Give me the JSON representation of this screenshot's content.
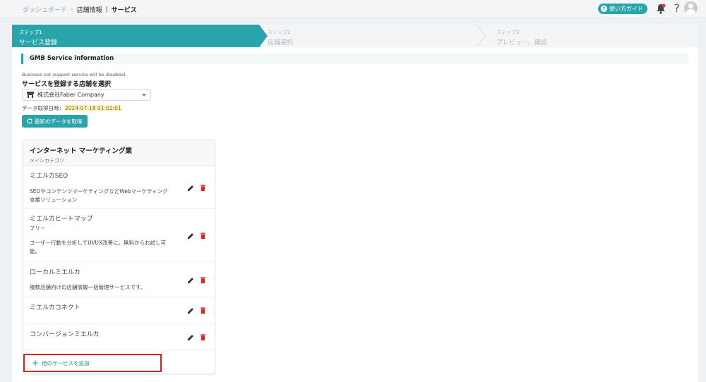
{
  "breadcrumb": {
    "items": [
      "ダッシュボード",
      "店舗情報",
      "サービス"
    ],
    "sep1": "›",
    "sep2": "|"
  },
  "topbar": {
    "guide_label": "使い方ガイド",
    "help_glyph": "?"
  },
  "steps": [
    {
      "num": "ステップ1",
      "label": "サービス登録"
    },
    {
      "num": "ステップ2",
      "label": "店舗選択"
    },
    {
      "num": "ステップ3",
      "label": "プレビュー、確認"
    }
  ],
  "section": {
    "title": "GMB Service information",
    "note": "Business not support service will be disabled.",
    "select_label": "サービスを登録する店舗を選択",
    "select_value": "株式会社Faber Company",
    "fetched_label": "データ取得日時：",
    "fetched_value": "2024-07-18 01:02:01",
    "refresh_label": "最新のデータを取得"
  },
  "category": {
    "title": "インターネット マーケティング業",
    "subtitle": "メインカテゴリ"
  },
  "services": [
    {
      "name": "ミエルカSEO",
      "lines": [
        "SEOやコンテンツマーケティングなどWebマーケティング",
        "支援ソリューション"
      ]
    },
    {
      "name": "ミエルカヒートマップ",
      "lines": [
        "フリー",
        "ユーザー行動を分析してUI/UX改善に。無料からお試し可",
        "能。"
      ]
    },
    {
      "name": "ローカルミエルカ",
      "lines": [
        "複数店舗向けの店舗情報一括管理サービスです。"
      ]
    },
    {
      "name": "ミエルカコネクト",
      "lines": []
    },
    {
      "name": "コンバージョンミエルカ",
      "lines": []
    }
  ],
  "add_service_label": "他のサービスを追加",
  "colors": {
    "accent": "#2aa4ab",
    "delete": "#e02424",
    "highlight_border": "#e21b1b"
  }
}
